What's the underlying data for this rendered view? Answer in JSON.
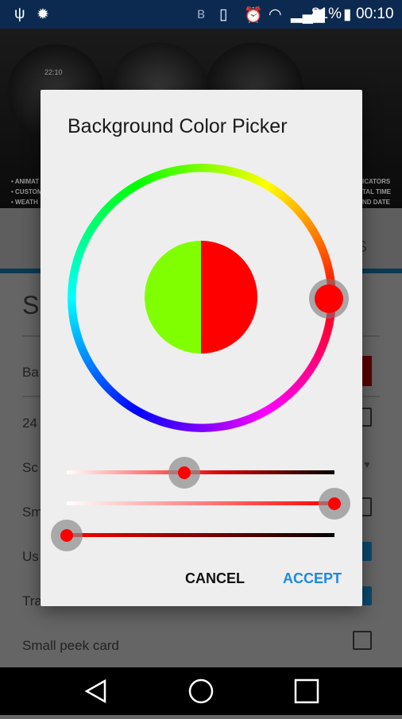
{
  "status_bar": {
    "icons": [
      "usb-icon",
      "android-debug-icon",
      "bluetooth-icon",
      "vibrate-icon",
      "alarm-icon",
      "wifi-icon",
      "signal-icon",
      "battery-charging-icon"
    ],
    "battery": "81%",
    "time": "00:10"
  },
  "banner": {
    "features_left": [
      "• ANIMAT",
      "• CUSTOM",
      "• WEATH"
    ],
    "features_right": [
      "ICATORS",
      "TAL TIME",
      "ND DATE"
    ],
    "watch_time": "22:10"
  },
  "background_list": {
    "tab_fragment": "S",
    "heading_fragment": "Su",
    "items": [
      {
        "label": "Ba",
        "control": "color-swatch"
      },
      {
        "label": "24",
        "control": "checkbox",
        "checked": false
      },
      {
        "label": "Sc",
        "control": "dropdown"
      },
      {
        "label": "Sm",
        "control": "checkbox",
        "checked": false
      },
      {
        "label": "Us",
        "control": "checkbox",
        "checked": true
      },
      {
        "label": "Tra",
        "control": "checkbox",
        "checked": true
      },
      {
        "label": "Small peek card",
        "control": "checkbox",
        "checked": false
      }
    ]
  },
  "dialog": {
    "title": "Background Color Picker",
    "hue_degrees": 0,
    "old_color": "#80ff00",
    "new_color": "#ff0000",
    "sliders": [
      {
        "name": "saturation-value",
        "value": 0.44
      },
      {
        "name": "opacity",
        "value": 1.0
      },
      {
        "name": "value",
        "value": 0.0
      }
    ],
    "cancel_label": "CANCEL",
    "accept_label": "ACCEPT",
    "accent": "#1e88e5"
  },
  "nav_bar": {
    "icons": [
      "back-icon",
      "home-icon",
      "recents-icon"
    ]
  }
}
